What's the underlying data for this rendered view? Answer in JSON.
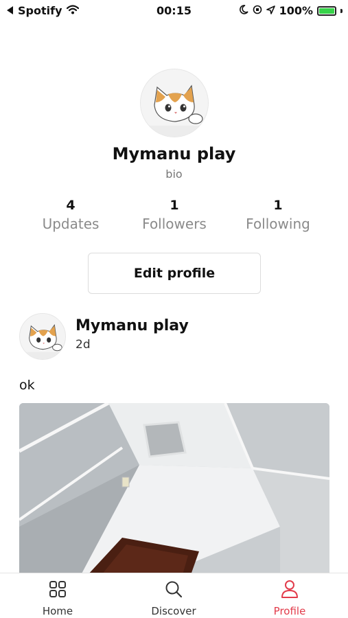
{
  "status_bar": {
    "carrier": "Spotify",
    "time": "00:15",
    "battery": "100%"
  },
  "profile": {
    "name": "Mymanu play",
    "bio": "bio",
    "stats": [
      {
        "value": "4",
        "label": "Updates"
      },
      {
        "value": "1",
        "label": "Followers"
      },
      {
        "value": "1",
        "label": "Following"
      }
    ],
    "edit_button_label": "Edit profile"
  },
  "post": {
    "author": "Mymanu play",
    "time": "2d",
    "text": "ok"
  },
  "bottom_nav": {
    "items": [
      {
        "label": "Home",
        "icon": "grid-icon"
      },
      {
        "label": "Discover",
        "icon": "search-icon"
      },
      {
        "label": "Profile",
        "icon": "user-icon"
      }
    ],
    "active": "Profile"
  },
  "colors": {
    "accent": "#e23b4a",
    "battery_green": "#38d34a"
  }
}
